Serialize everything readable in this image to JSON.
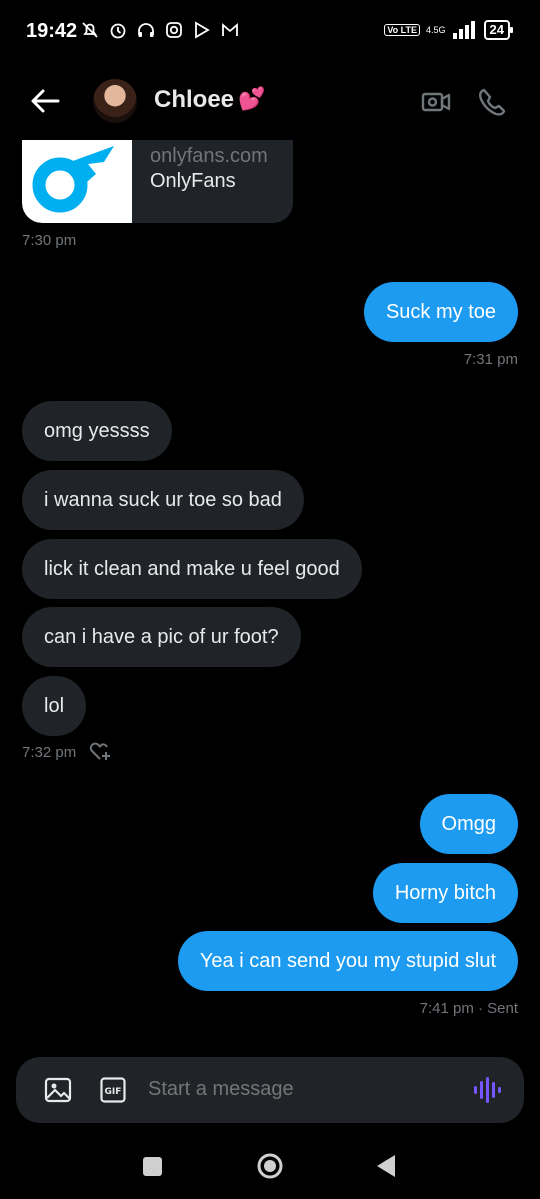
{
  "status_bar": {
    "time": "19:42",
    "network": "4.5G",
    "volte": "Vo LTE",
    "battery": "24"
  },
  "header": {
    "contact_name": "Chloee",
    "contact_emoji": "💕"
  },
  "link_card": {
    "domain": "onlyfans.com",
    "title": "OnlyFans"
  },
  "messages": [
    {
      "type": "time",
      "text": "7:30 pm"
    },
    {
      "type": "out",
      "text": "Suck my toe"
    },
    {
      "type": "time",
      "text": "7:31 pm"
    },
    {
      "type": "in",
      "text": "omg yessss"
    },
    {
      "type": "in",
      "text": "i wanna suck ur toe so bad"
    },
    {
      "type": "in",
      "text": "lick it clean and make u feel good"
    },
    {
      "type": "in",
      "text": "can i have a pic of ur foot?"
    },
    {
      "type": "in",
      "text": "lol"
    },
    {
      "type": "time",
      "text": "7:32 pm"
    },
    {
      "type": "out",
      "text": "Omgg"
    },
    {
      "type": "out",
      "text": "Horny bitch"
    },
    {
      "type": "out",
      "text": "Yea i can send you my stupid slut"
    },
    {
      "type": "time",
      "text": "7:41 pm · Sent"
    }
  ],
  "composer": {
    "placeholder": "Start a message",
    "gif_label": "GIF"
  },
  "colors": {
    "accent": "#1d9bf0",
    "incoming_bubble": "#202327",
    "muted": "#71767b",
    "voice": "#7856ff"
  }
}
